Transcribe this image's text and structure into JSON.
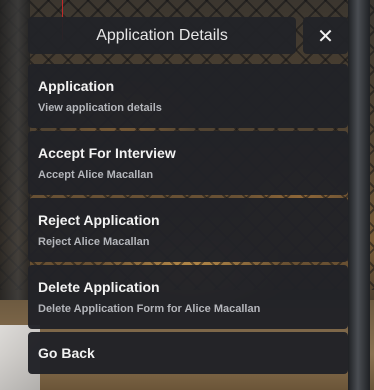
{
  "header": {
    "title": "Application Details",
    "close_glyph": "✕"
  },
  "menu": {
    "items": [
      {
        "title": "Application",
        "description": "View application details"
      },
      {
        "title": "Accept For Interview",
        "description": "Accept Alice Macallan"
      },
      {
        "title": "Reject Application",
        "description": "Reject Alice Macallan"
      },
      {
        "title": "Delete Application",
        "description": "Delete Application Form for Alice Macallan"
      },
      {
        "title": "Go Back"
      }
    ]
  },
  "colors": {
    "panel": "#222328",
    "title_text": "#e6e6e6",
    "item_title": "#f2f2f2",
    "item_desc": "#b4b6bb"
  }
}
